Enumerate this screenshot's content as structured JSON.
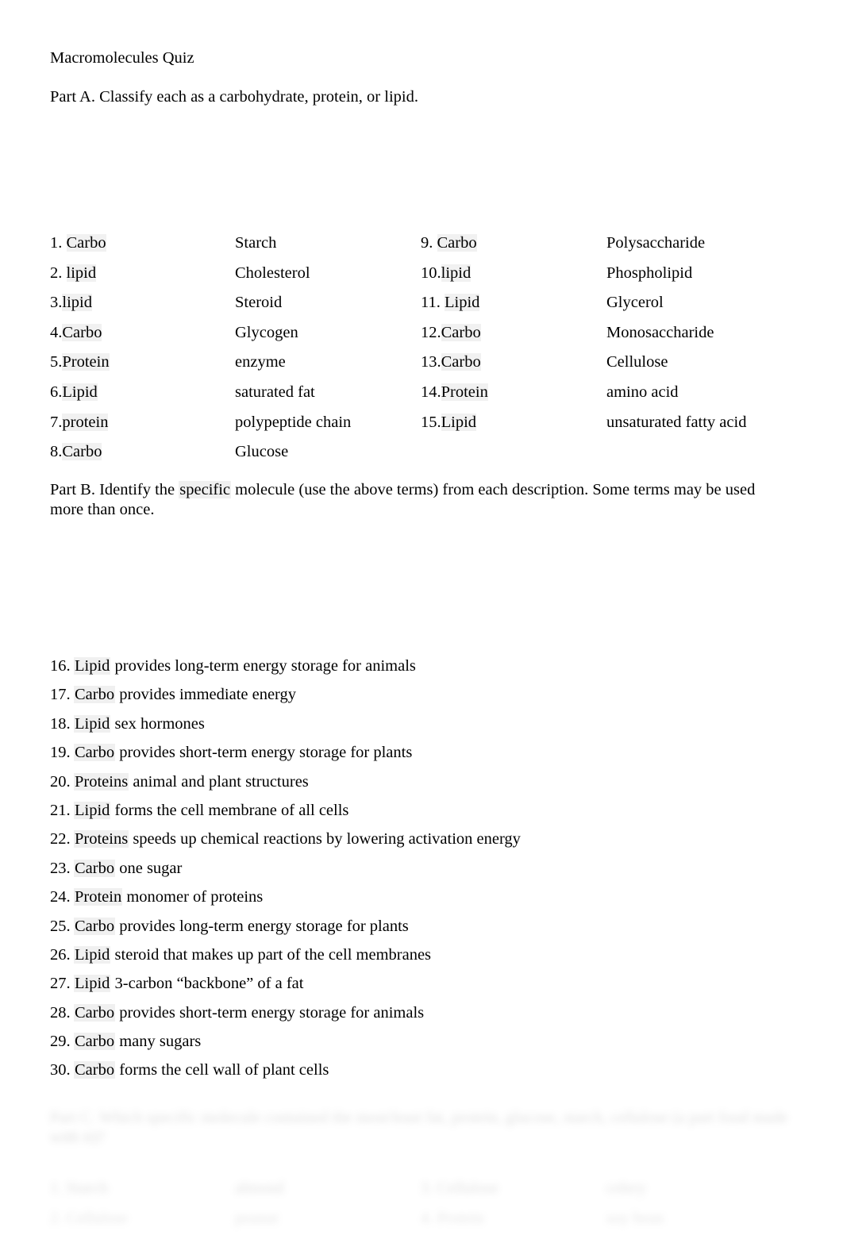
{
  "document": {
    "title": "Macromolecules Quiz"
  },
  "part_a": {
    "heading": "Part A.  Classify each as a carbohydrate, protein, or lipid.",
    "rows": [
      {
        "num_left": "1. ",
        "answer_left": "Carbo",
        "term_left": "Starch",
        "num_right": "9.  ",
        "answer_right": "Carbo",
        "term_right": "Polysaccharide"
      },
      {
        "num_left": "2. ",
        "answer_left": "lipid",
        "term_left": "Cholesterol",
        "num_right": "10.",
        "answer_right": "lipid",
        "term_right": "Phospholipid"
      },
      {
        "num_left": "3.",
        "answer_left": "lipid",
        "term_left": "Steroid",
        "num_right": "11. ",
        "answer_right": "Lipid",
        "term_right": "Glycerol"
      },
      {
        "num_left": "4.",
        "answer_left": "Carbo",
        "term_left": "Glycogen",
        "num_right": "12.",
        "answer_right": "Carbo",
        "term_right": "Monosaccharide"
      },
      {
        "num_left": "5.",
        "answer_left": "Protein",
        "term_left": "enzyme",
        "num_right": "13.",
        "answer_right": "Carbo",
        "term_right": "Cellulose"
      },
      {
        "num_left": "6.",
        "answer_left": "Lipid",
        "term_left": "saturated fat",
        "num_right": "14.",
        "answer_right": "Protein",
        "term_right": "amino acid"
      },
      {
        "num_left": "7.",
        "answer_left": "protein",
        "term_left": "polypeptide chain",
        "num_right": "15.",
        "answer_right": "Lipid",
        "term_right": "unsaturated fatty acid"
      },
      {
        "num_left": "8.",
        "answer_left": "Carbo",
        "term_left": "Glucose",
        "num_right": "",
        "answer_right": "",
        "term_right": ""
      }
    ]
  },
  "part_b": {
    "heading_before": "Part B.  Identify the ",
    "heading_highlight": "specific",
    "heading_after": " molecule (use the above terms) from each description. Some terms may be used more than once.",
    "items": [
      {
        "num": "16.",
        "answer": "Lipid",
        "text": " provides long-term energy storage for animals"
      },
      {
        "num": "17.",
        "answer": "Carbo",
        "text": " provides immediate energy"
      },
      {
        "num": "18.",
        "answer": "Lipid",
        "text": " sex hormones"
      },
      {
        "num": "19.",
        "answer": "Carbo",
        "text": " provides short-term energy storage for plants"
      },
      {
        "num": "20.",
        "answer": "Proteins",
        "text": " animal and plant structures"
      },
      {
        "num": "21.",
        "answer": "Lipid",
        "text": " forms the cell membrane of all cells"
      },
      {
        "num": "22.",
        "answer": "Proteins",
        "text": " speeds up chemical reactions by lowering activation energy"
      },
      {
        "num": "23.",
        "answer": "Carbo",
        "text": " one sugar"
      },
      {
        "num": "24.",
        "answer": "Protein",
        "text": " monomer of proteins"
      },
      {
        "num": "25.",
        "answer": "Carbo",
        "text": " provides long-term energy storage for plants"
      },
      {
        "num": "26.",
        "answer": "Lipid",
        "text": " steroid that makes up part of the cell membranes"
      },
      {
        "num": "27.",
        "answer": "Lipid",
        "text": " 3-carbon “backbone” of a fat"
      },
      {
        "num": "28.",
        "answer": "Carbo",
        "text": " provides short-term energy storage for animals"
      },
      {
        "num": "29.",
        "answer": "Carbo",
        "text": " many sugars"
      },
      {
        "num": "30.",
        "answer": "Carbo",
        "text": " forms the cell wall of plant cells"
      }
    ]
  },
  "part_c_preview": {
    "heading": "Part C.   Which specific molecule contained the most/least fat, protein, glucose, starch, cellulose (a part food made with it)?",
    "rows": [
      {
        "c1": "1. Starch",
        "c2": "almond",
        "c3": "3. Cellulose",
        "c4": "celery"
      },
      {
        "c1": "2. Cellulose",
        "c2": "peanut",
        "c3": "4. Protein",
        "c4": "soy bean"
      }
    ]
  }
}
